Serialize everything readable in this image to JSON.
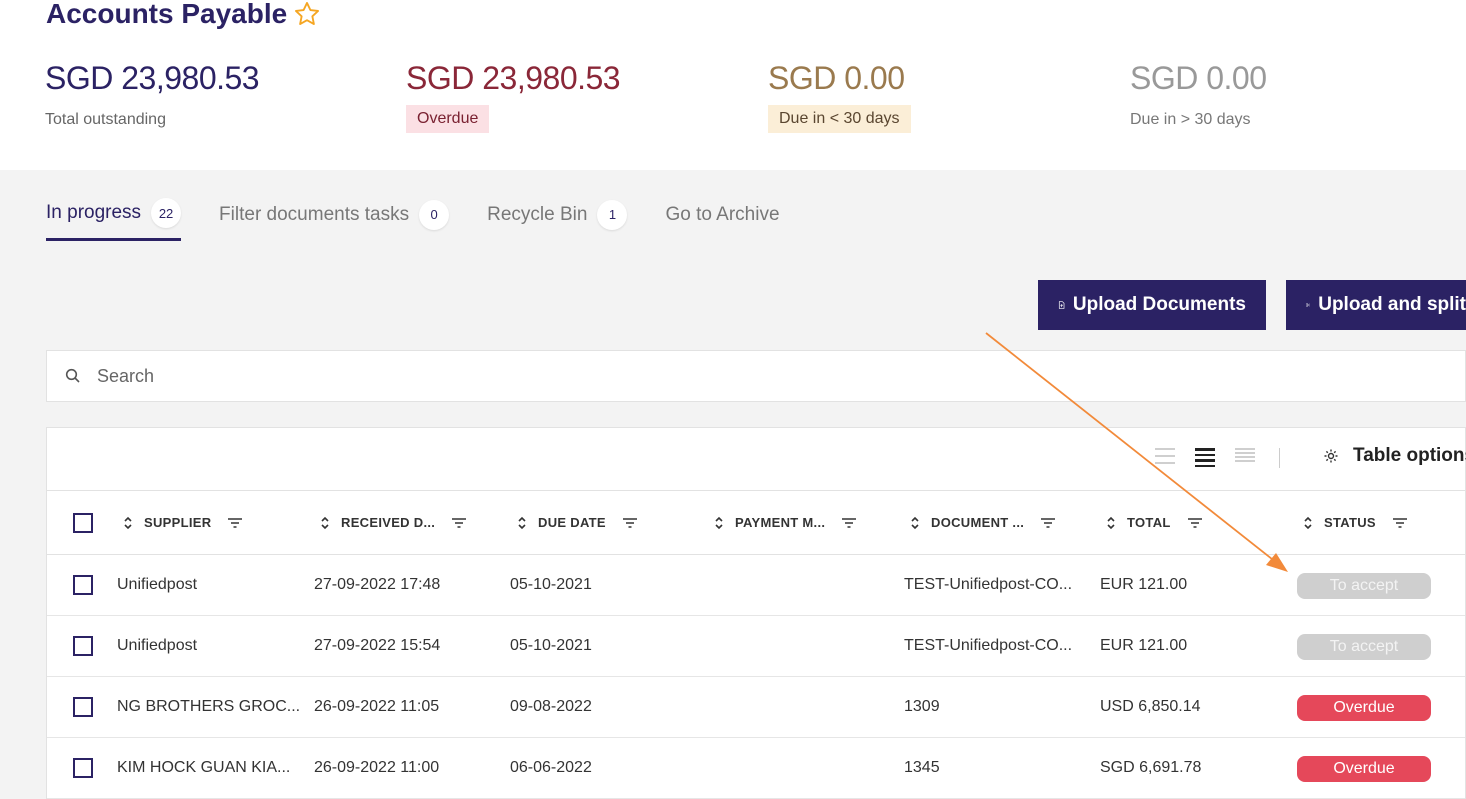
{
  "header": {
    "title": "Accounts Payable"
  },
  "kpis": {
    "total": {
      "amount": "SGD 23,980.53",
      "caption": "Total outstanding"
    },
    "overdue": {
      "amount": "SGD 23,980.53",
      "label": "Overdue"
    },
    "due_lt_30": {
      "amount": "SGD 0.00",
      "label": "Due in < 30 days"
    },
    "due_gt_30": {
      "amount": "SGD 0.00",
      "caption": "Due in > 30 days"
    }
  },
  "tabs": [
    {
      "label": "In progress",
      "count": "22"
    },
    {
      "label": "Filter documents tasks",
      "count": "0"
    },
    {
      "label": "Recycle Bin",
      "count": "1"
    },
    {
      "label": "Go to Archive"
    }
  ],
  "actions": {
    "upload": "Upload Documents",
    "split": "Upload and split"
  },
  "search": {
    "placeholder": "Search"
  },
  "table": {
    "options_label": "Table options",
    "columns": [
      "SUPPLIER",
      "RECEIVED D...",
      "DUE DATE",
      "PAYMENT M...",
      "DOCUMENT ...",
      "TOTAL",
      "STATUS"
    ],
    "rows": [
      {
        "supplier": "Unifiedpost",
        "received": "27-09-2022 17:48",
        "due": "05-10-2021",
        "payment": "",
        "document": "TEST-Unifiedpost-CO...",
        "total": "EUR 121.00",
        "status": "To accept"
      },
      {
        "supplier": "Unifiedpost",
        "received": "27-09-2022 15:54",
        "due": "05-10-2021",
        "payment": "",
        "document": "TEST-Unifiedpost-CO...",
        "total": "EUR 121.00",
        "status": "To accept"
      },
      {
        "supplier": "NG BROTHERS GROC...",
        "received": "26-09-2022 11:05",
        "due": "09-08-2022",
        "payment": "",
        "document": "1309",
        "total": "USD 6,850.14",
        "status": "Overdue"
      },
      {
        "supplier": "KIM HOCK GUAN KIA...",
        "received": "26-09-2022 11:00",
        "due": "06-06-2022",
        "payment": "",
        "document": "1345",
        "total": "SGD 6,691.78",
        "status": "Overdue"
      }
    ]
  },
  "colors": {
    "brand": "#2b2264",
    "overdue": "#e5485a",
    "to_accept": "#cfcfcf",
    "annotation_arrow": "#f28a3a",
    "star": "#f5a623"
  }
}
